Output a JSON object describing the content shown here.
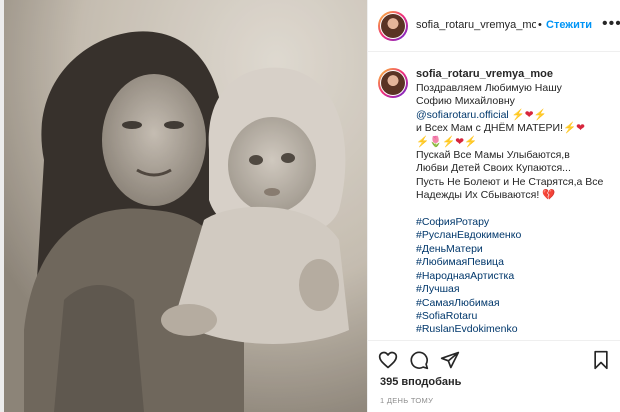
{
  "header": {
    "username": "sofia_rotaru_vremya_mo",
    "separator": "•",
    "follow_label": "Стежити",
    "more_label": "•••"
  },
  "caption": {
    "username": "sofia_rotaru_vremya_moe",
    "lines": [
      "Поздравляем Любимую Нашу",
      "Софию Михайловну",
      "@sofiarotaru.official",
      "и Всех Мам с ДНЁМ МАТЕРИ!",
      "",
      "Пускай Все Мамы Улыбаются,в",
      "Любви Детей Своих Купаются...",
      "Пусть Не Болеют и Не Старятся,а Все",
      "Надежды Их Сбываются!"
    ],
    "hashtags": [
      "#СофияРотару",
      "#РусланЕвдокименко",
      "#ДеньМатери",
      "#ЛюбимаяПевица",
      "#НароднаяАртистка",
      "#Лучшая",
      "#СамаяЛюбимая",
      "#SofiaRotaru",
      "#RuslanEvdokimenko"
    ],
    "emoji": {
      "bolt": "⚡",
      "heart": "❤",
      "tulip": "🌷",
      "broken_heart": "💔"
    }
  },
  "actions": {
    "like_icon": "heart-icon",
    "comment_icon": "comment-icon",
    "share_icon": "share-icon",
    "save_icon": "bookmark-icon"
  },
  "likes": {
    "count": "395",
    "label": "вподобань"
  },
  "timestamp": "1 ДЕНЬ ТОМУ",
  "colors": {
    "link": "#00376b",
    "follow": "#0095f6",
    "text": "#262626",
    "muted": "#8e8e8e"
  }
}
